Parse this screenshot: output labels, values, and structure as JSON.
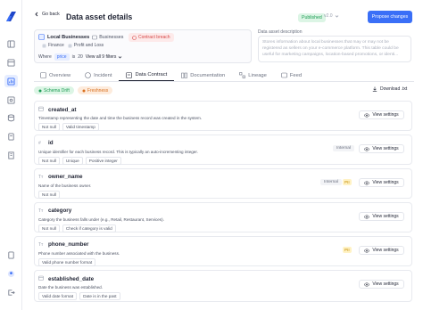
{
  "header": {
    "back_label": "Go back",
    "title": "Data asset details",
    "status_badge": "Published",
    "version": "v2.0",
    "propose_label": "Propose changes"
  },
  "asset": {
    "name": "Local Businesses",
    "crumb": "Businesses",
    "breach": "Contract breach",
    "tags": [
      "Finance",
      "Profit and Loss"
    ],
    "where_label": "Where",
    "filter_field": "price",
    "filter_op": "is",
    "filter_value": "20",
    "view_all": "View all 9 filters"
  },
  "description": {
    "label": "Data asset description",
    "text": "Stores information about local businesses that may or may not be registered as sellers on your e-commerce platform. This table could be useful for marketing campaigns, location-based promotions, or identi..."
  },
  "tabs": [
    {
      "label": "Overview",
      "icon": "overview-icon"
    },
    {
      "label": "Incident",
      "icon": "incident-icon"
    },
    {
      "label": "Data Contract",
      "icon": "contract-icon",
      "active": true
    },
    {
      "label": "Documentation",
      "icon": "book-icon"
    },
    {
      "label": "Lineage",
      "icon": "lineage-icon"
    },
    {
      "label": "Feed",
      "icon": "feed-icon"
    }
  ],
  "filters": {
    "schema_drift": "Schema Drift",
    "freshness": "Freshness",
    "download": "Download .txt"
  },
  "view_settings": "View settings",
  "fields": [
    {
      "type_icon": "calendar-icon",
      "name": "created_at",
      "description": "Timestamp representing the date and time the business record was created in the system.",
      "tests": [
        "Not null",
        "Valid timestamp"
      ],
      "internal": "",
      "pii": ""
    },
    {
      "type_icon": "hash-icon",
      "name": "id",
      "description": "Unique identifier for each business record. This is typically an auto-incrementing integer.",
      "tests": [
        "Not null",
        "Unique",
        "Positive integer"
      ],
      "internal": "Internal",
      "pii": ""
    },
    {
      "type_icon": "text-icon",
      "name": "owner_name",
      "description": "Name of the business owner.",
      "tests": [
        "Not null"
      ],
      "internal": "Internal",
      "pii": "PII"
    },
    {
      "type_icon": "text-icon",
      "name": "category",
      "description": "Category the business falls under (e.g., Retail, Restaurant, Services).",
      "tests": [
        "Not null",
        "Check if category is valid"
      ],
      "internal": "",
      "pii": ""
    },
    {
      "type_icon": "text-icon",
      "name": "phone_number",
      "description": "Phone number associated with the business.",
      "tests": [
        "Valid phone number format"
      ],
      "internal": "",
      "pii": "PII"
    },
    {
      "type_icon": "calendar-icon",
      "name": "established_date",
      "description": "Date the business was established.",
      "tests": [
        "Valid date format",
        "Date is in the past"
      ],
      "internal": "",
      "pii": ""
    }
  ]
}
